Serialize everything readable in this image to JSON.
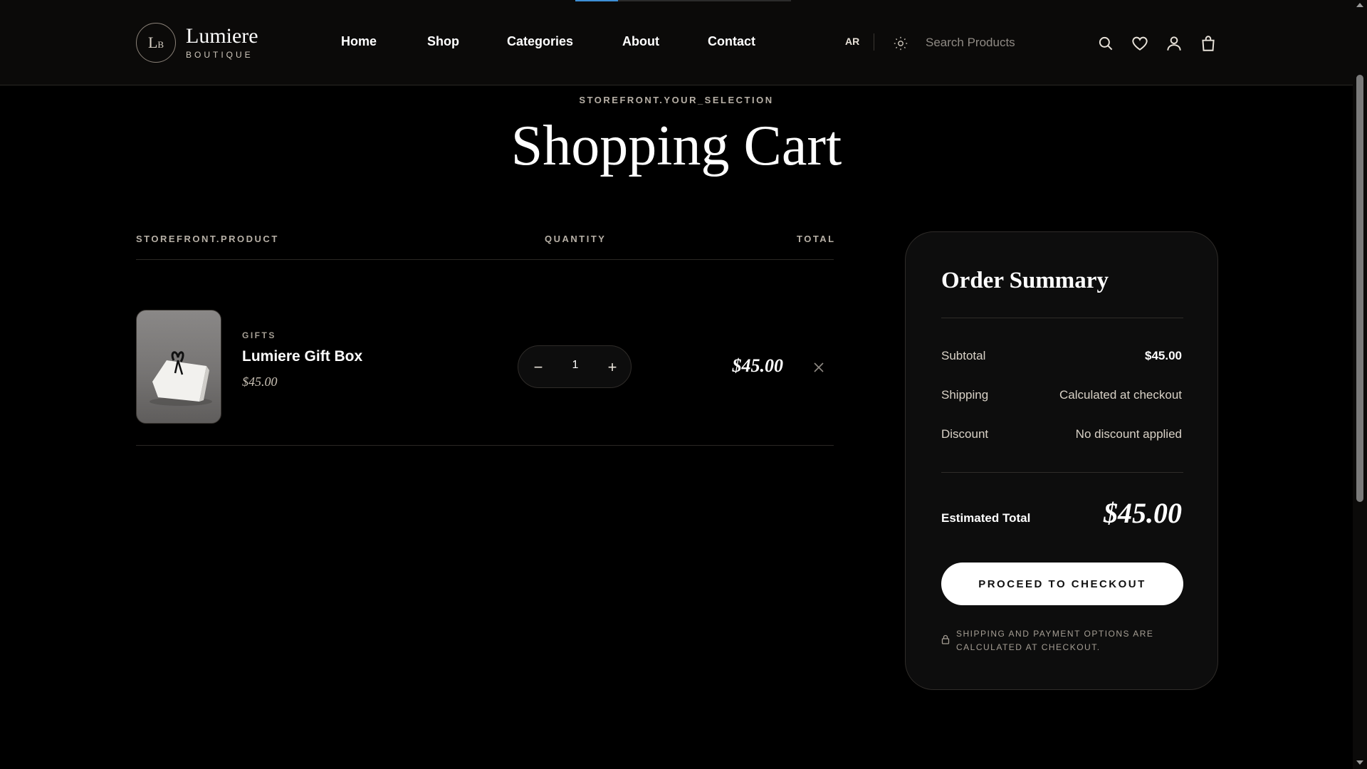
{
  "brand": {
    "monogram": "LB",
    "name": "Lumiere",
    "tagline": "BOUTIQUE"
  },
  "nav": {
    "items": [
      "Home",
      "Shop",
      "Categories",
      "About",
      "Contact"
    ]
  },
  "header": {
    "lang": "AR",
    "search_placeholder": "Search Products",
    "icons": [
      "sun-icon",
      "search-icon",
      "heart-icon",
      "user-icon",
      "bag-icon"
    ]
  },
  "page": {
    "eyebrow": "STOREFRONT.YOUR_SELECTION",
    "title": "Shopping Cart"
  },
  "cart": {
    "headers": {
      "product": "STOREFRONT.PRODUCT",
      "quantity": "QUANTITY",
      "total": "TOTAL"
    },
    "items": [
      {
        "category": "GIFTS",
        "name": "Lumiere Gift Box",
        "price": "$45.00",
        "quantity": "1",
        "total": "$45.00"
      }
    ],
    "stepper": {
      "minus": "−",
      "plus": "+"
    }
  },
  "summary": {
    "title": "Order Summary",
    "subtotal_label": "Subtotal",
    "subtotal_value": "$45.00",
    "shipping_label": "Shipping",
    "shipping_value": "Calculated at checkout",
    "discount_label": "Discount",
    "discount_value": "No discount applied",
    "estimated_label": "Estimated Total",
    "estimated_value": "$45.00",
    "checkout_label": "PROCEED TO CHECKOUT",
    "note": "SHIPPING AND PAYMENT OPTIONS ARE CALCULATED AT CHECKOUT."
  },
  "colors": {
    "background": "#000000",
    "header_bg": "#0b0a09",
    "card_bg": "#0d0d0d",
    "accent_loading": "#3d8fd6",
    "muted_text": "#b7b0a6"
  }
}
